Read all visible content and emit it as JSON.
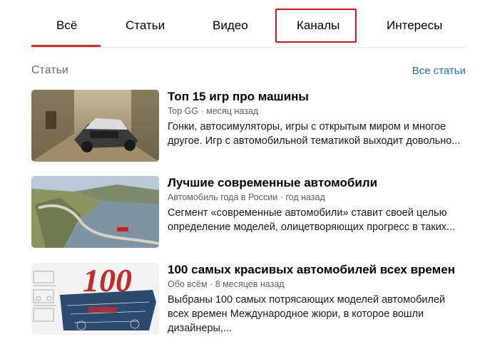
{
  "tabs": [
    {
      "label": "Всё"
    },
    {
      "label": "Статьи"
    },
    {
      "label": "Видео"
    },
    {
      "label": "Каналы"
    },
    {
      "label": "Интересы"
    }
  ],
  "section": {
    "title": "Статьи",
    "all_link": "Все статьи"
  },
  "articles": [
    {
      "title": "Топ 15 игр про машины",
      "source": "Top GG",
      "separator": "·",
      "time": "месяц назад",
      "description": "Гонки, автосимуляторы, игры с открытым миром и многое другое. Игр с автомобильной тематикой выходит довольно..."
    },
    {
      "title": "Лучшие современные автомобили",
      "source": "Автомобиль года в России",
      "separator": "·",
      "time": "год назад",
      "description": "Сегмент «современные автомобили» ставит своей целью определение моделей, олицетворяющих прогресс в таких..."
    },
    {
      "title": "100 самых красивых автомобилей всех времен",
      "source": "Обо всём",
      "separator": "·",
      "time": "8 месяцев назад",
      "description": "Выбраны 100 самых потрясающих моделей автомобилей всех времен Международное жюри, в которое вошли дизайнеры,..."
    }
  ],
  "colors": {
    "active_tab_underline": "#e52b23",
    "highlight_box": "#d9151b",
    "link": "#1b73c9"
  }
}
